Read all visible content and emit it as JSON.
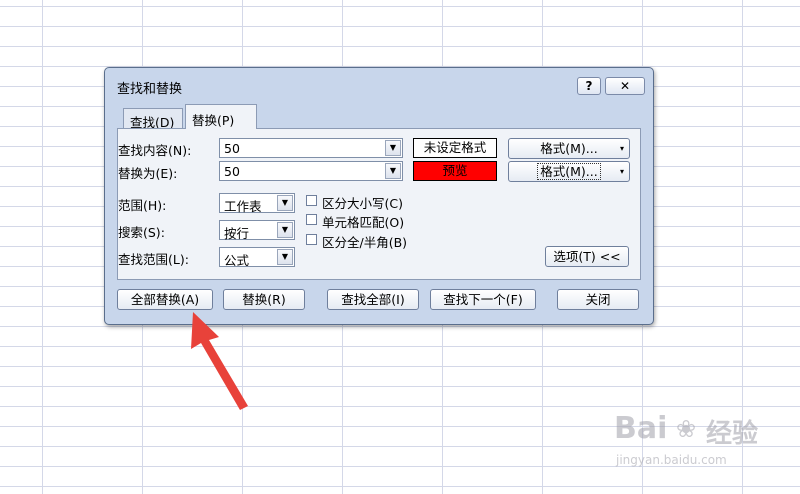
{
  "dialog": {
    "title": "查找和替换",
    "help_label": "?",
    "close_label": "✕",
    "tabs": [
      {
        "label": "查找(D)"
      },
      {
        "label": "替换(P)"
      }
    ],
    "find_label": "查找内容(N):",
    "find_value": "50",
    "replace_label": "替换为(E):",
    "replace_value": "50",
    "find_format_status": "未设定格式",
    "replace_preview": "预览",
    "format_button_1": "格式(M)...",
    "format_button_2": "格式(M)...",
    "scope_label": "范围(H):",
    "scope_value": "工作表",
    "search_label": "搜索(S):",
    "search_value": "按行",
    "lookin_label": "查找范围(L):",
    "lookin_value": "公式",
    "options": {
      "match_case": "区分大小写(C)",
      "match_cell": "单元格匹配(O)",
      "match_width": "区分全/半角(B)"
    },
    "options_button": "选项(T) <<",
    "buttons": {
      "replace_all": "全部替换(A)",
      "replace": "替换(R)",
      "find_all": "查找全部(I)",
      "find_next": "查找下一个(F)",
      "close": "关闭"
    }
  },
  "watermark": {
    "brand": "Bai",
    "brand_cn": "经验",
    "url": "jingyan.baidu.com"
  },
  "colors": {
    "preview_fill": "#ff0000",
    "annotation_arrow": "#e8423a",
    "dialog_bg": "#c8d6eb"
  }
}
